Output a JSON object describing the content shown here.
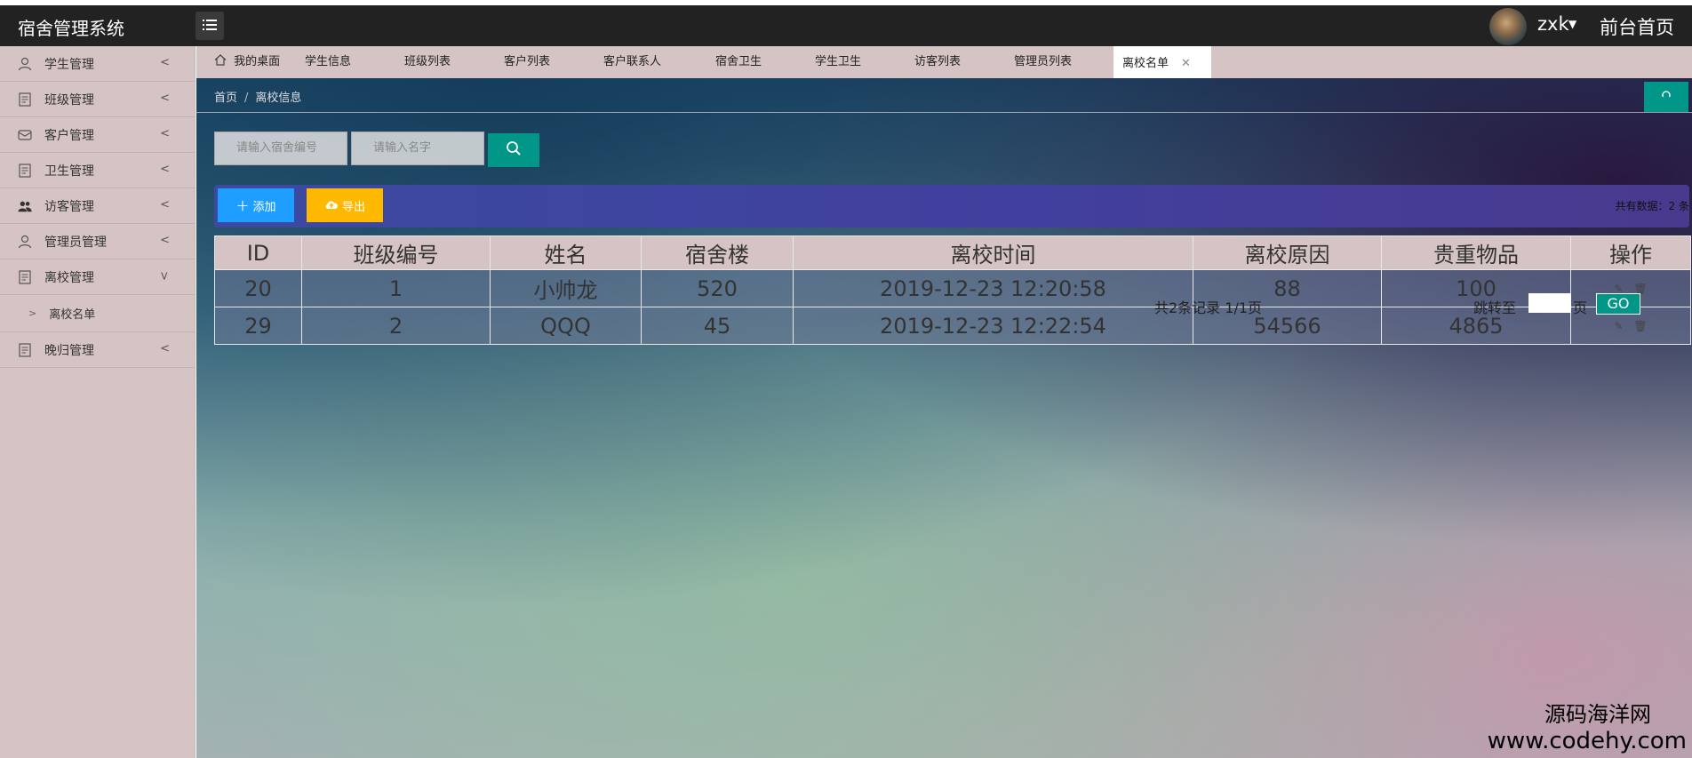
{
  "header": {
    "app_title": "宿舍管理系统",
    "menu_icon": "list-icon",
    "username": "zxk",
    "front_link": "前台首页"
  },
  "sidebar": {
    "items": [
      {
        "label": "学生管理",
        "icon": "user-icon"
      },
      {
        "label": "班级管理",
        "icon": "document-icon"
      },
      {
        "label": "客户管理",
        "icon": "mail-icon"
      },
      {
        "label": "卫生管理",
        "icon": "document-icon"
      },
      {
        "label": "访客管理",
        "icon": "users-icon"
      },
      {
        "label": "管理员管理",
        "icon": "user-icon"
      },
      {
        "label": "离校管理",
        "icon": "document-icon"
      },
      {
        "label": "晚归管理",
        "icon": "document-icon"
      }
    ],
    "sub_item": "离校名单"
  },
  "tabs": [
    {
      "label": "我的桌面"
    },
    {
      "label": "学生信息"
    },
    {
      "label": "班级列表"
    },
    {
      "label": "客户列表"
    },
    {
      "label": "客户联系人"
    },
    {
      "label": "宿舍卫生"
    },
    {
      "label": "学生卫生"
    },
    {
      "label": "访客列表"
    },
    {
      "label": "管理员列表"
    },
    {
      "label": "离校名单"
    }
  ],
  "breadcrumb": {
    "home": "首页",
    "sep": "/",
    "current": "离校信息"
  },
  "search": {
    "dorm_placeholder": "请输入宿舍编号",
    "name_placeholder": "请输入名字"
  },
  "toolbar": {
    "add_label": "添加",
    "export_label": "导出",
    "total": "共有数据：2 条"
  },
  "table": {
    "headers": [
      "ID",
      "班级编号",
      "姓名",
      "宿舍楼",
      "离校时间",
      "离校原因",
      "贵重物品",
      "操作"
    ],
    "rows": [
      [
        "20",
        "1",
        "小帅龙",
        "520",
        "2019-12-23 12:20:58",
        "88",
        "100"
      ],
      [
        "29",
        "2",
        "QQQ",
        "45",
        "2019-12-23 12:22:54",
        "54566",
        "4865"
      ]
    ]
  },
  "pager": {
    "summary": "共2条记录  1/1页",
    "goto_label": "跳转至",
    "page_unit": "页",
    "go": "GO"
  },
  "watermark": {
    "line1": "源码海洋网",
    "line2": "www.codehy.com"
  },
  "colors": {
    "teal": "#009688",
    "blue": "#1e9fff",
    "orange": "#ffb800",
    "sidebar_bg": "#d6c3c3",
    "topbar_bg": "#222222"
  }
}
